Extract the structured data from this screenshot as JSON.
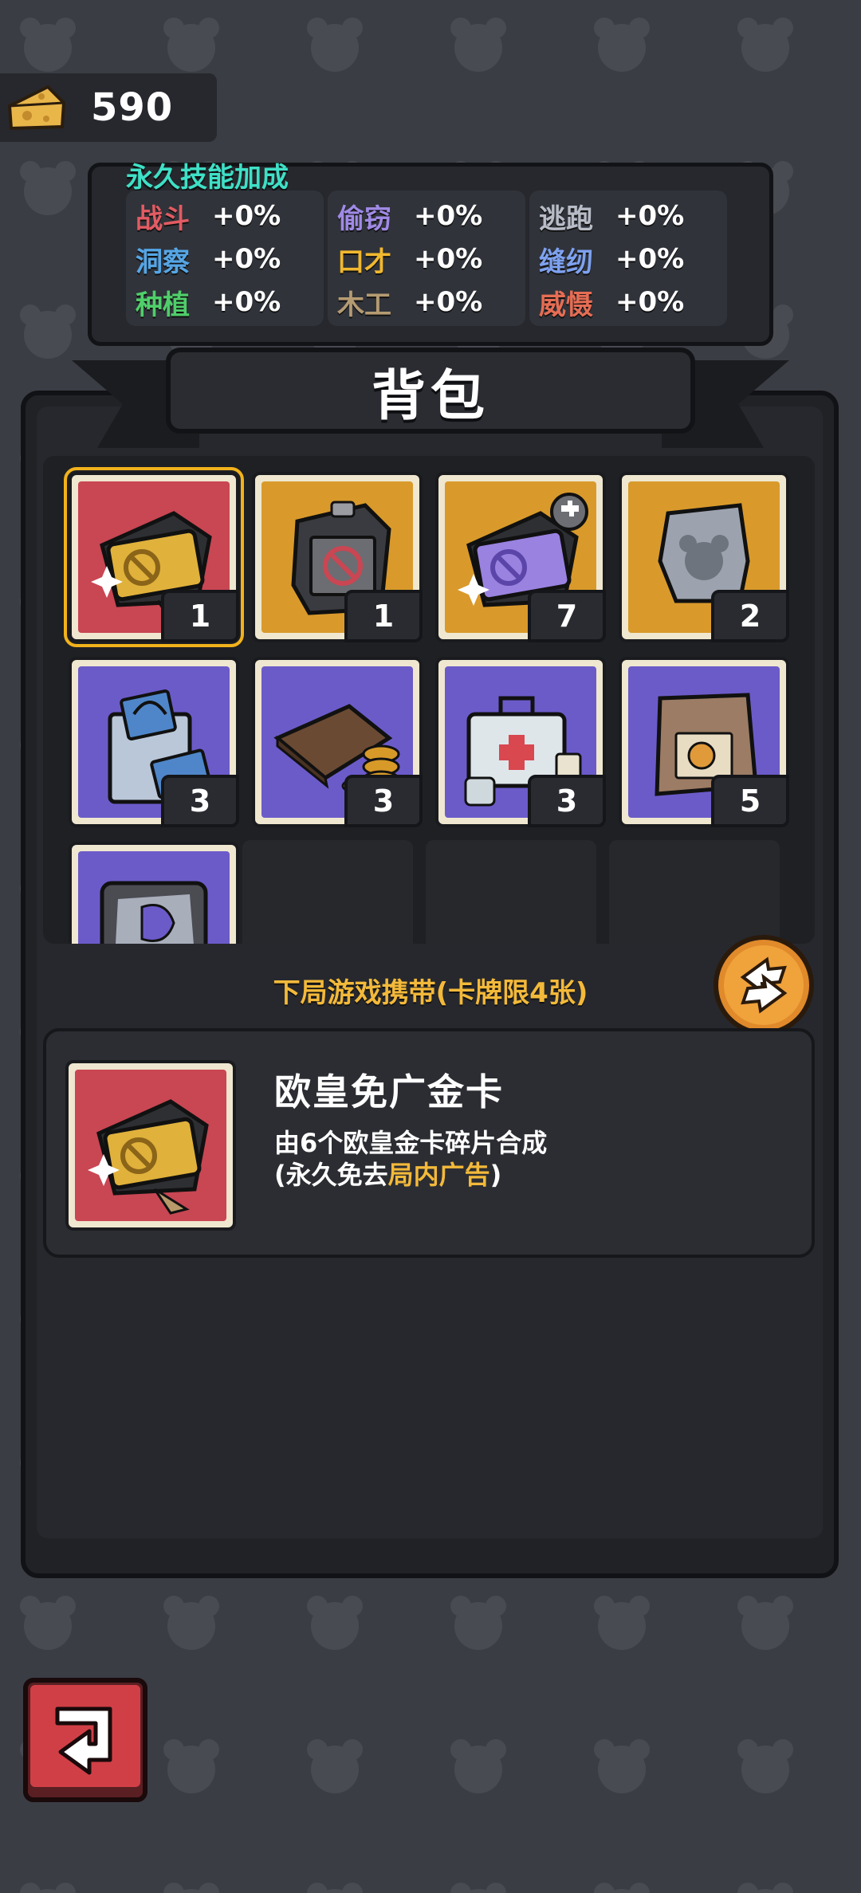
{
  "currency": {
    "icon": "cheese-icon",
    "value": "590"
  },
  "skills": {
    "title": "永久技能加成",
    "columns": [
      [
        {
          "name": "战斗",
          "value": "+0%",
          "color": "#e35b63"
        },
        {
          "name": "洞察",
          "value": "+0%",
          "color": "#55a6e6"
        },
        {
          "name": "种植",
          "value": "+0%",
          "color": "#4fcf6a"
        }
      ],
      [
        {
          "name": "偷窃",
          "value": "+0%",
          "color": "#a08ae6"
        },
        {
          "name": "口才",
          "value": "+0%",
          "color": "#f1b82f"
        },
        {
          "name": "木工",
          "value": "+0%",
          "color": "#b59b72"
        }
      ],
      [
        {
          "name": "逃跑",
          "value": "+0%",
          "color": "#b7bcc6"
        },
        {
          "name": "缝纫",
          "value": "+0%",
          "color": "#7ea2f0"
        },
        {
          "name": "威慑",
          "value": "+0%",
          "color": "#e66d54"
        }
      ]
    ]
  },
  "backpack": {
    "title": "背包",
    "items": [
      {
        "icon": "gold-card-icon",
        "count": "1",
        "bg": "red",
        "selected": true
      },
      {
        "icon": "no-ads-box-icon",
        "count": "1",
        "bg": "orange"
      },
      {
        "icon": "card-fragment-icon",
        "count": "7",
        "bg": "orange"
      },
      {
        "icon": "mouse-tag-icon",
        "count": "2",
        "bg": "orange"
      },
      {
        "icon": "money-bag-icon",
        "count": "3",
        "bg": "purple"
      },
      {
        "icon": "wallet-coins-icon",
        "count": "3",
        "bg": "purple"
      },
      {
        "icon": "first-aid-kit-icon",
        "count": "3",
        "bg": "purple"
      },
      {
        "icon": "paper-bag-icon",
        "count": "5",
        "bg": "purple"
      },
      {
        "icon": "cheese-pouch-icon",
        "count": "",
        "bg": "purple"
      }
    ]
  },
  "carry_label": "下局游戏携带(卡牌限4张)",
  "detail": {
    "name": "欧皇免广金卡",
    "desc_line1": "由6个欧皇金卡碎片合成",
    "desc_line2_pre": "(永久免去",
    "desc_line2_hl": "局内广告",
    "desc_line2_post": ")"
  },
  "colors": {
    "accent": "#f3b93a",
    "selected_border": "#f2b21b",
    "skills_title": "#3ee0c6"
  }
}
